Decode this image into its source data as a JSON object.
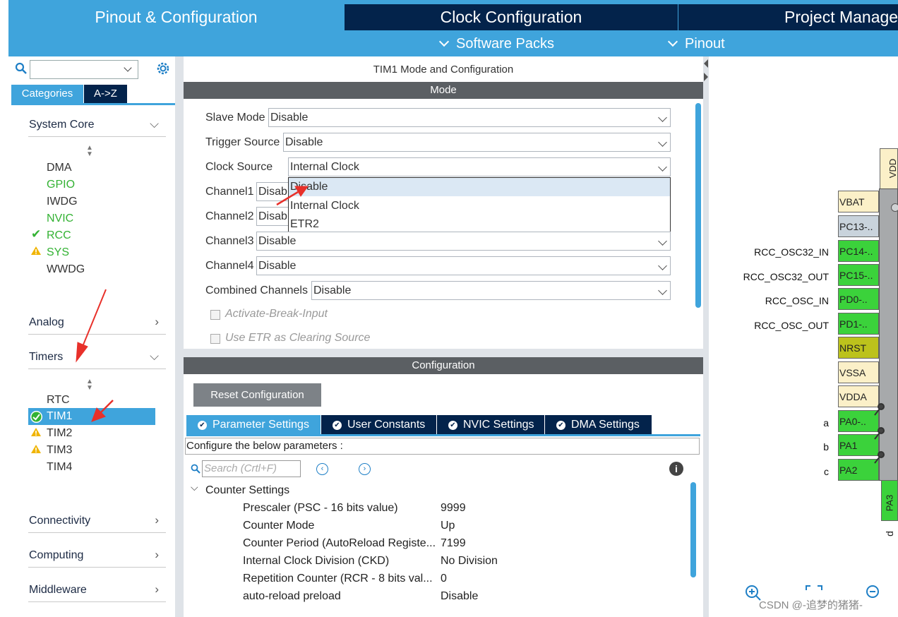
{
  "top_tabs": {
    "pinout": "Pinout & Configuration",
    "clock": "Clock Configuration",
    "project": "Project Manage"
  },
  "sub_menu": {
    "software_packs": "Software Packs",
    "pinout": "Pinout"
  },
  "sidebar": {
    "tabs": {
      "categories": "Categories",
      "az": "A->Z"
    },
    "categories": {
      "system_core": "System Core",
      "analog": "Analog",
      "timers": "Timers",
      "connectivity": "Connectivity",
      "computing": "Computing",
      "middleware": "Middleware"
    },
    "system_core_items": [
      "DMA",
      "GPIO",
      "IWDG",
      "NVIC",
      "RCC",
      "SYS",
      "WWDG"
    ],
    "timer_items": [
      "RTC",
      "TIM1",
      "TIM2",
      "TIM3",
      "TIM4"
    ]
  },
  "mode_panel": {
    "title": "TIM1 Mode and Configuration",
    "mode_header": "Mode",
    "slave_mode": {
      "label": "Slave Mode",
      "value": "Disable"
    },
    "trigger_source": {
      "label": "Trigger Source",
      "value": "Disable"
    },
    "clock_source": {
      "label": "Clock Source",
      "value": "Internal Clock"
    },
    "channel1": {
      "label": "Channel1",
      "value": "Disab"
    },
    "channel2": {
      "label": "Channel2",
      "value": "Disab"
    },
    "channel3": {
      "label": "Channel3",
      "value": "Disable"
    },
    "channel4": {
      "label": "Channel4",
      "value": "Disable"
    },
    "combined_channels": {
      "label": "Combined Channels",
      "value": "Disable"
    },
    "activate_break": "Activate-Break-Input",
    "use_etr": "Use ETR as Clearing Source",
    "clock_options": [
      "Disable",
      "Internal Clock",
      "ETR2"
    ]
  },
  "config_panel": {
    "header": "Configuration",
    "reset_button": "Reset Configuration",
    "tabs": [
      "Parameter Settings",
      "User Constants",
      "NVIC Settings",
      "DMA Settings"
    ],
    "hint": "Configure the below parameters :",
    "search_placeholder": "Search (Crtl+F)",
    "group": "Counter Settings",
    "params": [
      {
        "name": "Prescaler (PSC - 16 bits value)",
        "value": "9999"
      },
      {
        "name": "Counter Mode",
        "value": "Up"
      },
      {
        "name": "Counter Period (AutoReload Registe...",
        "value": "7199"
      },
      {
        "name": "Internal Clock Division (CKD)",
        "value": "No Division"
      },
      {
        "name": "Repetition Counter (RCR - 8 bits val...",
        "value": "0"
      },
      {
        "name": "auto-reload preload",
        "value": "Disable"
      }
    ]
  },
  "chip_view": {
    "top_pin": "VDD",
    "pins": [
      "VBAT",
      "PC13-..",
      "PC14-..",
      "PC15-..",
      "PD0-..",
      "PD1-..",
      "NRST",
      "VSSA",
      "VDDA",
      "PA0-..",
      "PA1",
      "PA2"
    ],
    "bottom_pin": "PA3",
    "labels": [
      "RCC_OSC32_IN",
      "RCC_OSC32_OUT",
      "RCC_OSC_IN",
      "RCC_OSC_OUT",
      "a",
      "b",
      "c",
      "d"
    ],
    "watermark": "CSDN @-追梦的猪猪-"
  }
}
